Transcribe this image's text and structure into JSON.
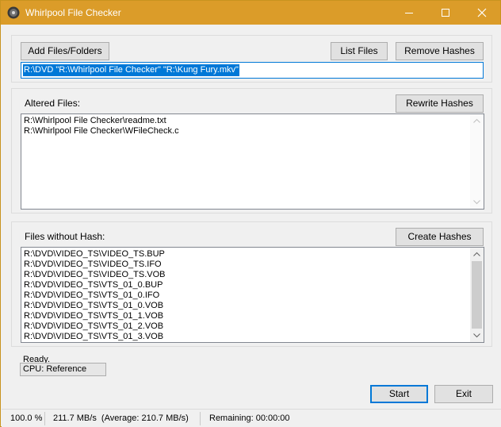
{
  "window": {
    "title": "Whirlpool File Checker",
    "accent_color": "#db9c29",
    "icon": "disc-app-icon",
    "controls": [
      "minimize-icon",
      "maximize-icon",
      "close-icon"
    ]
  },
  "top": {
    "add_label": "Add Files/Folders",
    "list_label": "List Files",
    "remove_label": "Remove Hashes",
    "path_value": "R:\\DVD \"R:\\Whirlpool File Checker\" \"R:\\Kung Fury.mkv\""
  },
  "altered": {
    "label": "Altered Files:",
    "button_label": "Rewrite Hashes",
    "items": [
      "R:\\Whirlpool File Checker\\readme.txt",
      "R:\\Whirlpool File Checker\\WFileCheck.c"
    ]
  },
  "nohash": {
    "label": "Files without Hash:",
    "button_label": "Create Hashes",
    "items": [
      "R:\\DVD\\VIDEO_TS\\VIDEO_TS.BUP",
      "R:\\DVD\\VIDEO_TS\\VIDEO_TS.IFO",
      "R:\\DVD\\VIDEO_TS\\VIDEO_TS.VOB",
      "R:\\DVD\\VIDEO_TS\\VTS_01_0.BUP",
      "R:\\DVD\\VIDEO_TS\\VTS_01_0.IFO",
      "R:\\DVD\\VIDEO_TS\\VTS_01_0.VOB",
      "R:\\DVD\\VIDEO_TS\\VTS_01_1.VOB",
      "R:\\DVD\\VIDEO_TS\\VTS_01_2.VOB",
      "R:\\DVD\\VIDEO_TS\\VTS_01_3.VOB"
    ]
  },
  "status": {
    "text": "Ready.",
    "cpu_label": "CPU: Reference",
    "start_label": "Start",
    "exit_label": "Exit"
  },
  "statusbar": {
    "percent": "100.0 %",
    "speed": "211.7 MB/s  (Average: 210.7 MB/s)",
    "remaining": "Remaining: 00:00:00"
  }
}
